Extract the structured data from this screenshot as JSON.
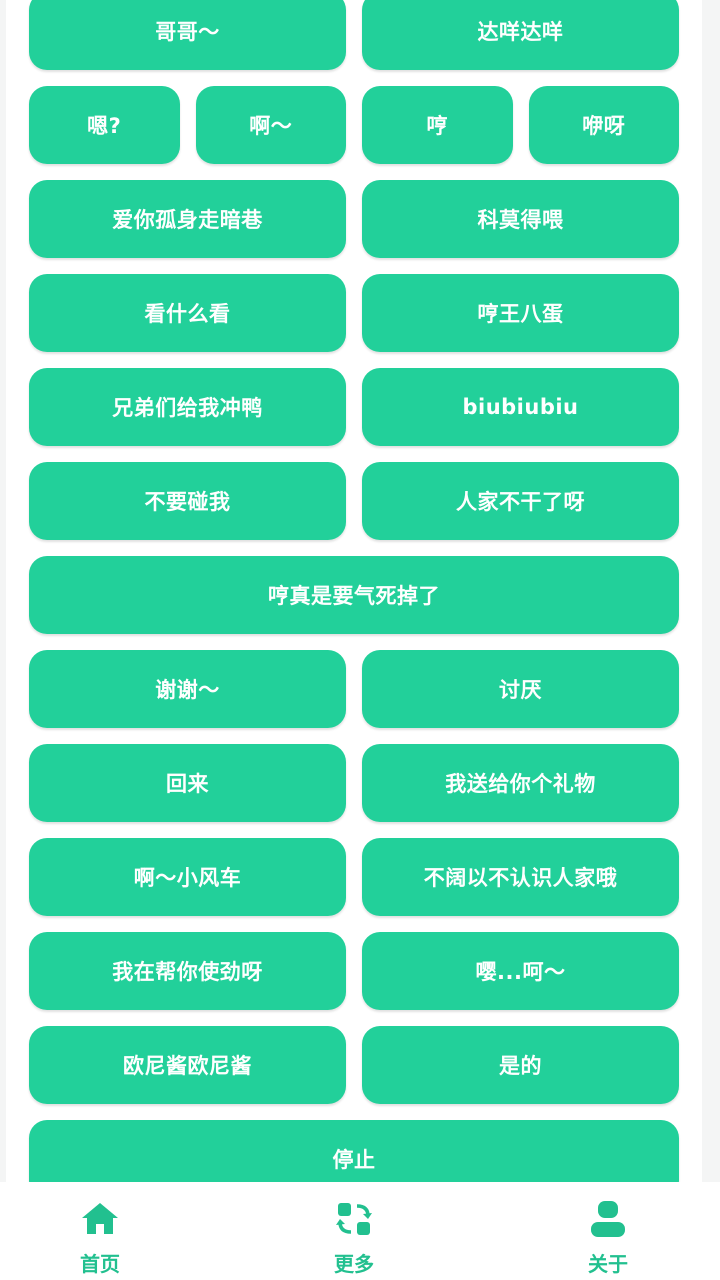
{
  "buttons": [
    [
      "哥哥～",
      "达咩达咩"
    ],
    [
      "嗯?",
      "啊～",
      "哼",
      "咿呀"
    ],
    [
      "爱你孤身走暗巷",
      "科莫得喂"
    ],
    [
      "看什么看",
      "哼王八蛋"
    ],
    [
      "兄弟们给我冲鸭",
      "biubiubiu"
    ],
    [
      "不要碰我",
      "人家不干了呀"
    ],
    [
      "哼真是要气死掉了"
    ],
    [
      "谢谢～",
      "讨厌"
    ],
    [
      "回来",
      "我送给你个礼物"
    ],
    [
      "啊～小风车",
      "不阔以不认识人家哦"
    ],
    [
      "我在帮你使劲呀",
      "嘤...呵～"
    ],
    [
      "欧尼酱欧尼酱",
      "是的"
    ],
    [
      "停止"
    ]
  ],
  "tabs": {
    "home": "首页",
    "more": "更多",
    "about": "关于"
  },
  "colors": {
    "accent": "#22d09a",
    "tab_text": "#22c08f"
  }
}
